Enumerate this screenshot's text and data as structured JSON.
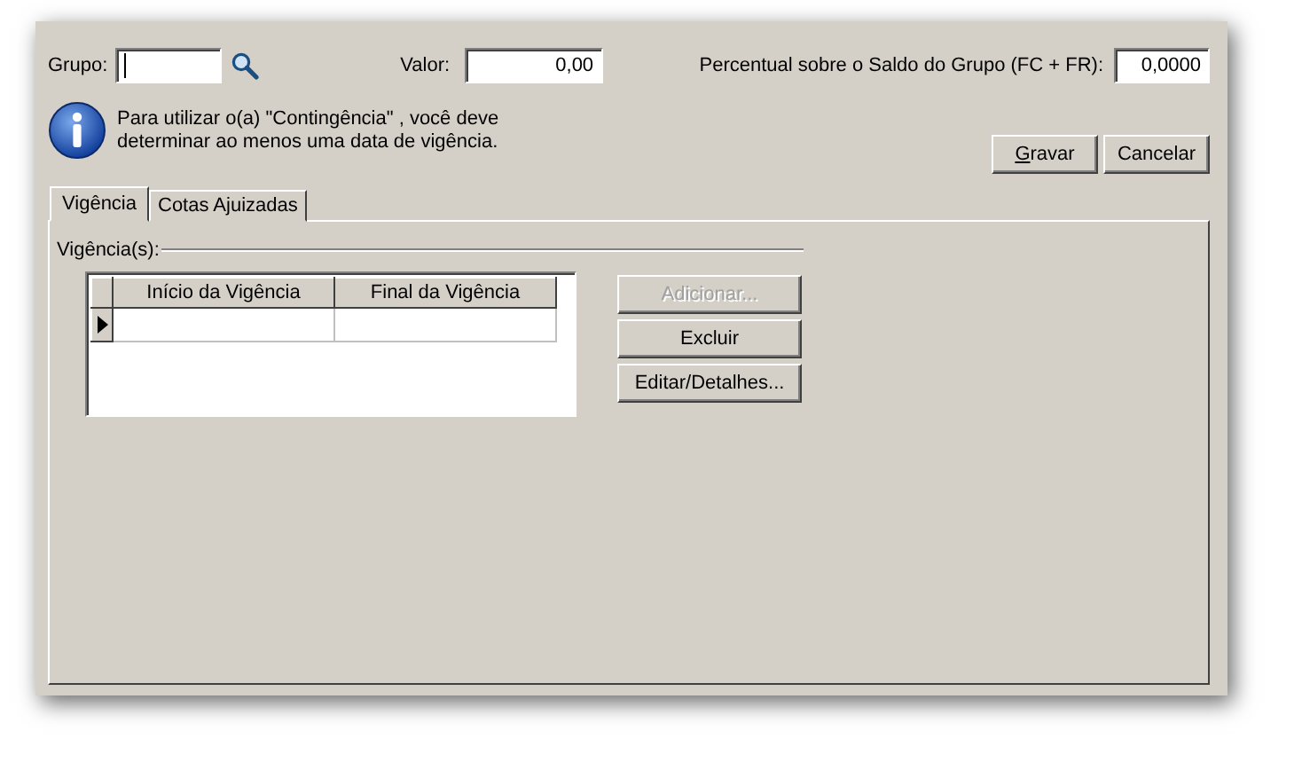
{
  "header": {
    "grupo_label": "Grupo:",
    "valor_label": "Valor:",
    "valor_value": "0,00",
    "percentual_label": "Percentual sobre o Saldo do Grupo (FC + FR):",
    "percentual_value": "0,0000"
  },
  "info_message": "Para utilizar o(a) \"Contingência\" , você deve determinar ao menos uma data de vigência.",
  "actions": [
    {
      "label": "Gravar",
      "mnemonic_underlined": true
    },
    {
      "label": "Cancelar",
      "mnemonic_underlined": false
    }
  ],
  "tabs": [
    {
      "label": "Vigência",
      "selected": true
    },
    {
      "label": "Cotas Ajuizadas",
      "selected": false
    }
  ],
  "group_title": "Vigência(s):",
  "table": {
    "columns": [
      "Início da Vigência",
      "Final da Vigência"
    ],
    "rows": [
      {
        "current": true
      }
    ]
  },
  "side_buttons": [
    {
      "label": "Adicionar...",
      "disabled": true
    },
    {
      "label": "Excluir",
      "disabled": false
    },
    {
      "label": "Editar/Detalhes...",
      "disabled": false
    }
  ]
}
